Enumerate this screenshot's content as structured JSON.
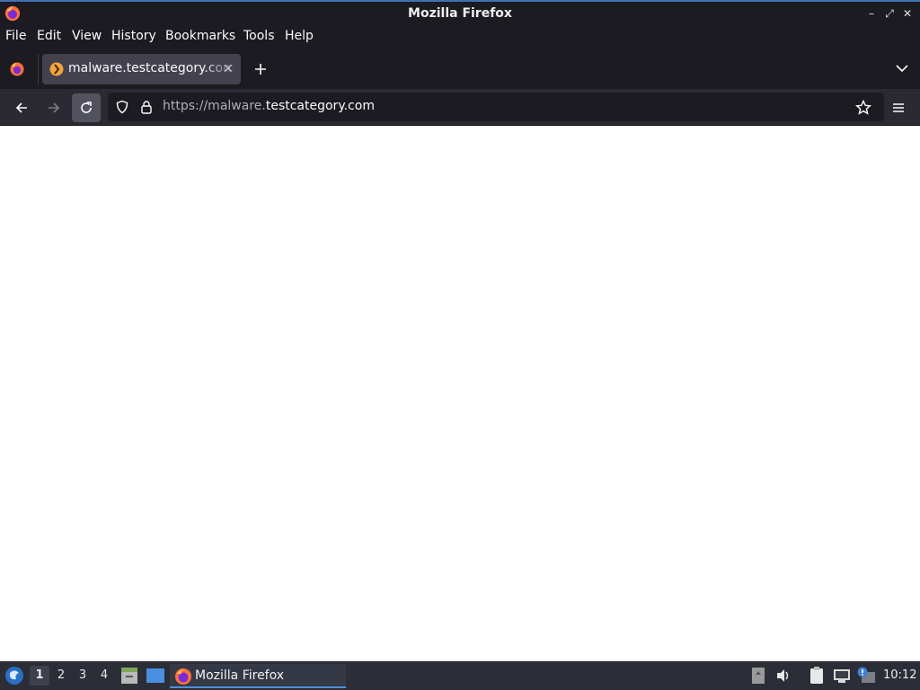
{
  "window": {
    "title": "Mozilla Firefox"
  },
  "menu": {
    "items": [
      "File",
      "Edit",
      "View",
      "History",
      "Bookmarks",
      "Tools",
      "Help"
    ]
  },
  "tabs": [
    {
      "title": "malware.testcategory.com"
    }
  ],
  "urlbar": {
    "prefix": "https://malware.",
    "domain": "testcategory.com"
  },
  "taskbar": {
    "workspaces": [
      "1",
      "2",
      "3",
      "4"
    ],
    "active_workspace": "1",
    "task_label": "Mozilla Firefox",
    "clock": "10:12"
  },
  "colors": {
    "chrome_dark": "#1c1b22",
    "toolbar": "#2b2a33",
    "tab_active": "#42414d",
    "accent": "#4f8fdd"
  }
}
